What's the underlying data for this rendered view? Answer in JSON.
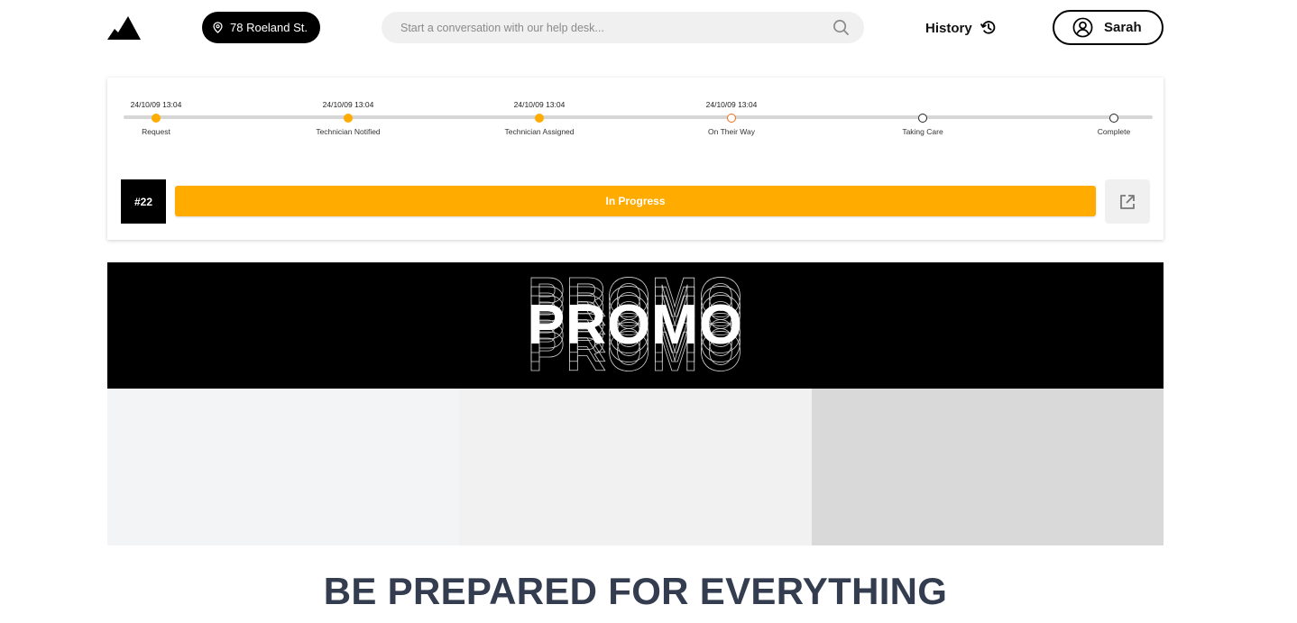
{
  "header": {
    "address": "78 Roeland St.",
    "search_placeholder": "Start a conversation with our help desk...",
    "history_label": "History",
    "user_name": "Sarah"
  },
  "tracker": {
    "steps": [
      {
        "label": "Request",
        "date": "24/10/09 13:04",
        "state": "done"
      },
      {
        "label": "Technician Notified",
        "date": "24/10/09 13:04",
        "state": "done"
      },
      {
        "label": "Technician Assigned",
        "date": "24/10/09 13:04",
        "state": "done"
      },
      {
        "label": "On Their Way",
        "date": "24/10/09 13:04",
        "state": "current"
      },
      {
        "label": "Taking Care",
        "date": "",
        "state": "pending"
      },
      {
        "label": "Complete",
        "date": "",
        "state": "pending"
      }
    ],
    "ticket_number": "#22",
    "status": "In Progress"
  },
  "promo": {
    "text": "PROMO"
  },
  "tagline": "BE PREPARED FOR EVERYTHING",
  "colors": {
    "accent": "#ffab00",
    "current_step": "#f26a1b",
    "tagline": "#333d4f"
  }
}
